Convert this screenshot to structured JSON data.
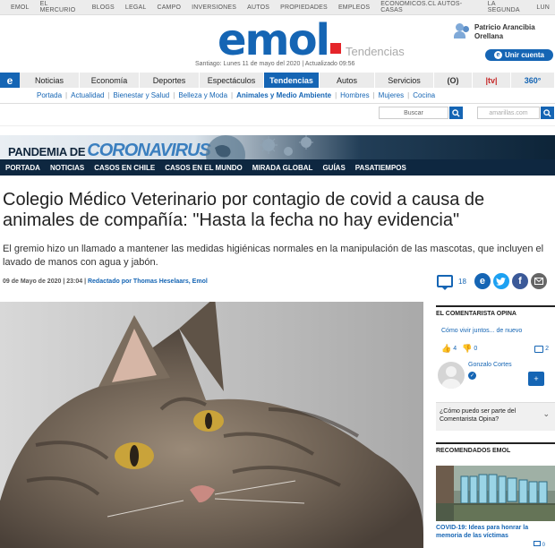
{
  "topbar": {
    "links": [
      "EMOL",
      "EL MERCURIO",
      "BLOGS",
      "LEGAL",
      "CAMPO",
      "INVERSIONES",
      "AUTOS",
      "PROPIEDADES",
      "EMPLEOS",
      "ECONOMICOS.CL AUTOS- CASAS",
      "LA SEGUNDA",
      "LUN"
    ]
  },
  "header": {
    "logo": "emol",
    "section": "Tendencias",
    "date_line": "Santiago: Lunes 11 de mayo del 2020 | Actualizado 09:56",
    "user_name": "Patricio Arancibia Orellana",
    "login_label": "Unir cuenta"
  },
  "nav": {
    "logo_letter": "e",
    "items": [
      "Noticias",
      "Economía",
      "Deportes",
      "Espectáculos",
      "Tendencias",
      "Autos",
      "Servicios"
    ],
    "active_index": 4,
    "icons": [
      "(O)",
      "|tv|",
      "360°"
    ],
    "sub_items": [
      "Portada",
      "Actualidad",
      "Bienestar y Salud",
      "Belleza y Moda",
      "Animales y Medio Ambiente",
      "Hombres",
      "Mujeres",
      "Cocina"
    ]
  },
  "search": {
    "placeholder": "Buscar",
    "amarillas_placeholder": "amarillas.com"
  },
  "covid_banner": {
    "title_prefix": "PANDEMIA DE",
    "title_main": "CORONAVIRUS",
    "links": [
      "PORTADA",
      "NOTICIAS",
      "CASOS EN CHILE",
      "CASOS EN EL MUNDO",
      "MIRADA GLOBAL",
      "GUÍAS",
      "PASATIEMPOS"
    ]
  },
  "article": {
    "headline": "Colegio Médico Veterinario por contagio de covid a causa de animales de compañía: \"Hasta la fecha no hay evidencia\"",
    "lead": "El gremio hizo un llamado a mantener las medidas higiénicas normales en la manipulación de las mascotas, que incluyen el lavado de manos con agua y jabón.",
    "date": "09 de Mayo de 2020 | 23:04 | ",
    "author": "Redactado por Thomas Heselaars, Emol",
    "comment_count": "18",
    "share_emol": "e",
    "share_fb": "f"
  },
  "sidebar": {
    "comentarista_title": "EL COMENTARISTA OPINA",
    "comment_link": "Cómo vivir juntos... de nuevo",
    "likes": "4",
    "dislikes": "0",
    "comments": "2",
    "commenter_name": "Gonzalo Cortes",
    "faq": "¿Cómo puedo ser parte del Comentarista Opina?",
    "recommended_title": "RECOMENDADOS EMOL",
    "reco_caption": "COVID-19: Ideas para honrar la memoria de las víctimas",
    "reco_comments": "0"
  },
  "colors": {
    "brand_blue": "#1565b4",
    "brand_red": "#e5252a",
    "covid_dark": "#0e2740"
  }
}
